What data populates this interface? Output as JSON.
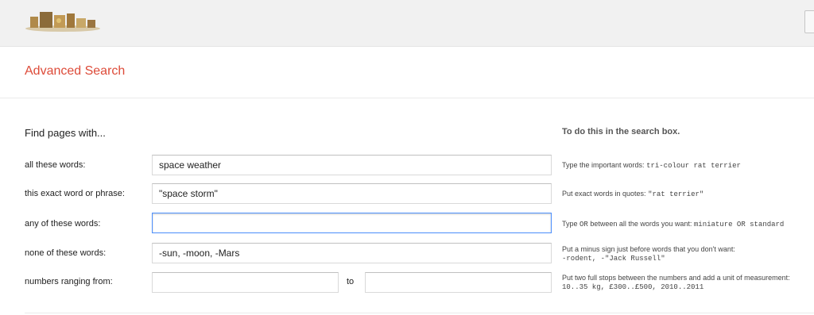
{
  "header": {
    "logo_icon": "google-doodle-logo"
  },
  "page": {
    "title": "Advanced Search"
  },
  "form": {
    "heading": "Find pages with...",
    "help_heading": "To do this in the search box.",
    "rows": [
      {
        "label": "all these words:",
        "value": "space weather",
        "help_text": "Type the important words: ",
        "help_code": "tri-colour rat terrier"
      },
      {
        "label": "this exact word or phrase:",
        "value": "\"space storm\"",
        "help_text": "Put exact words in quotes: ",
        "help_code": "\"rat terrier\""
      },
      {
        "label": "any of these words:",
        "value": "",
        "help_text_a": "Type ",
        "help_code_a": "OR",
        "help_text_b": " between all the words you want: ",
        "help_code_b": "miniature OR standard"
      },
      {
        "label": "none of these words:",
        "value": "-sun, -moon, -Mars",
        "help_text": "Put a minus sign just before words that you don't want:",
        "help_code": "-rodent, -\"Jack Russell\""
      },
      {
        "label": "numbers ranging from:",
        "value_from": "",
        "to_label": "to",
        "value_to": "",
        "help_text": "Put two full stops between the numbers and add a unit of measurement:",
        "help_code": "10..35 kg, £300..£500, 2010..2011"
      }
    ]
  }
}
